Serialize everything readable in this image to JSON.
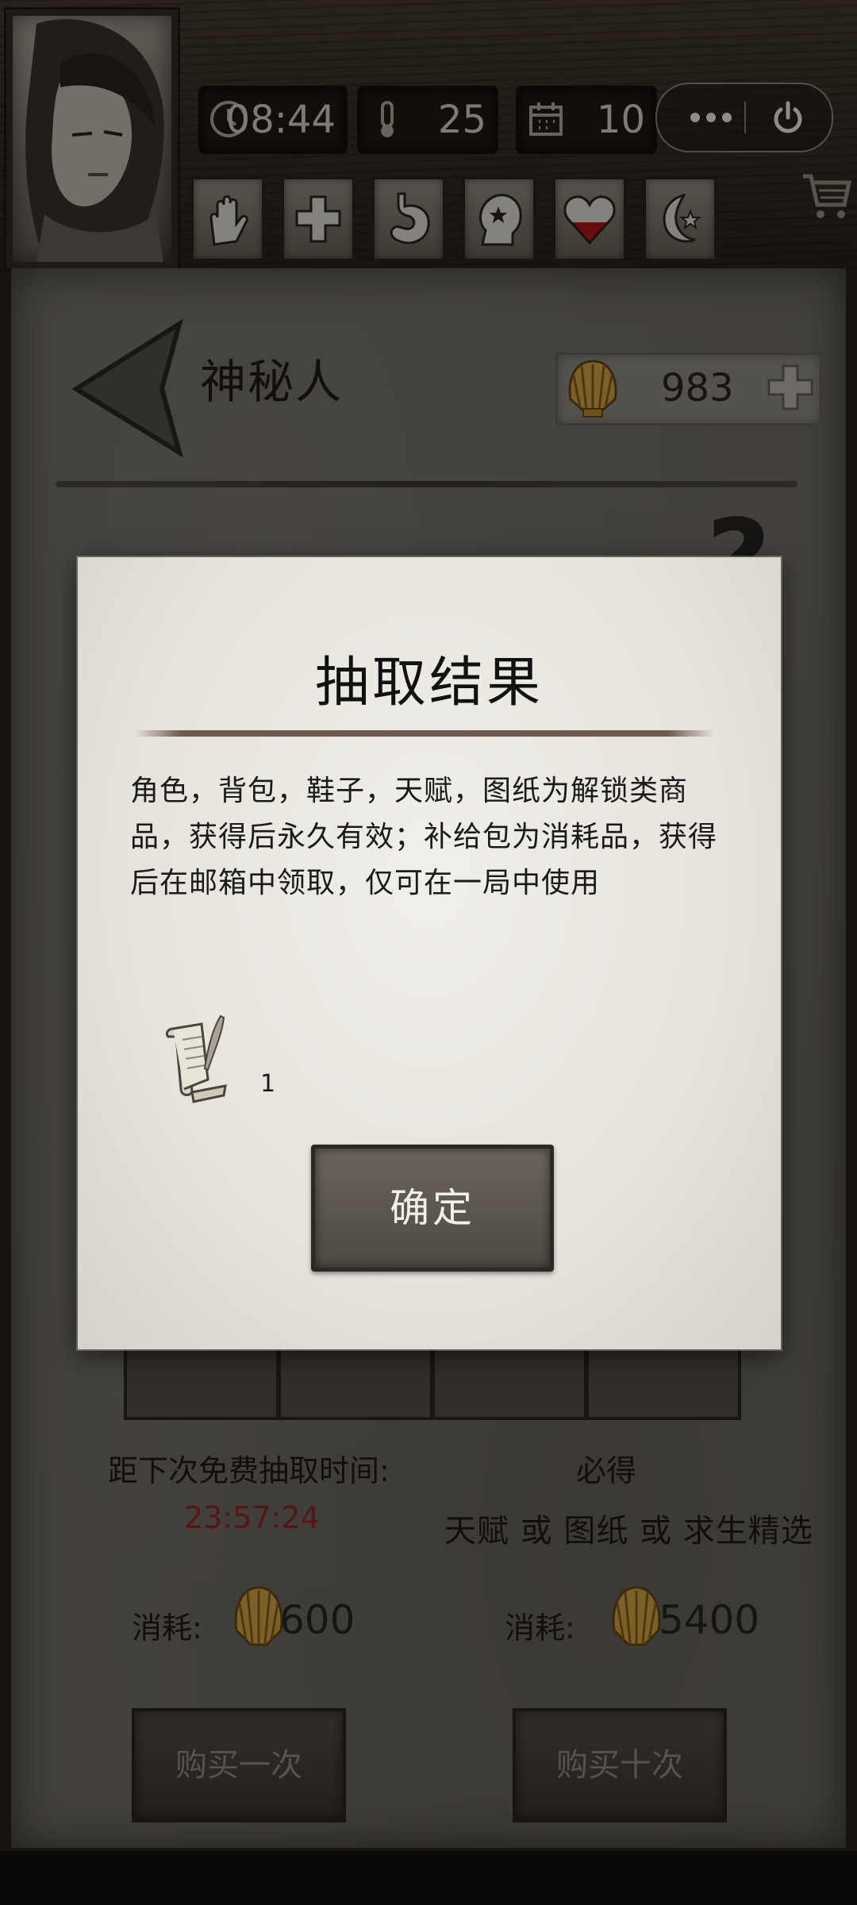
{
  "header": {
    "time": "08:44",
    "temperature": "25",
    "day": "10",
    "status_icons": [
      "hand-icon",
      "health-cross-icon",
      "stomach-icon",
      "head-icon",
      "heart-icon",
      "moon-icon"
    ],
    "heart_level": 0.45
  },
  "page": {
    "title": "神秘人",
    "shell_count": "983",
    "timer_label": "距下次免费抽取时间:",
    "timer_value": "23:57:24",
    "bonus_title": "必得",
    "bonus_desc": "天赋 或 图纸 或 求生精选",
    "cost_label": "消耗:",
    "cost_single": "600",
    "cost_ten": "5400",
    "buy_once": "购买一次",
    "buy_ten": "购买十次"
  },
  "modal": {
    "title": "抽取结果",
    "body": "角色，背包，鞋子，天赋，图纸为解锁类商品，获得后永久有效；补给包为消耗品，获得后在邮箱中领取，仅可在一局中使用",
    "item_icon": "scroll-quill-icon",
    "item_qty": "1",
    "confirm": "确定"
  },
  "colors": {
    "timer_red": "#a12623",
    "paper": "#e6e3dc",
    "wood": "#3a3129"
  }
}
